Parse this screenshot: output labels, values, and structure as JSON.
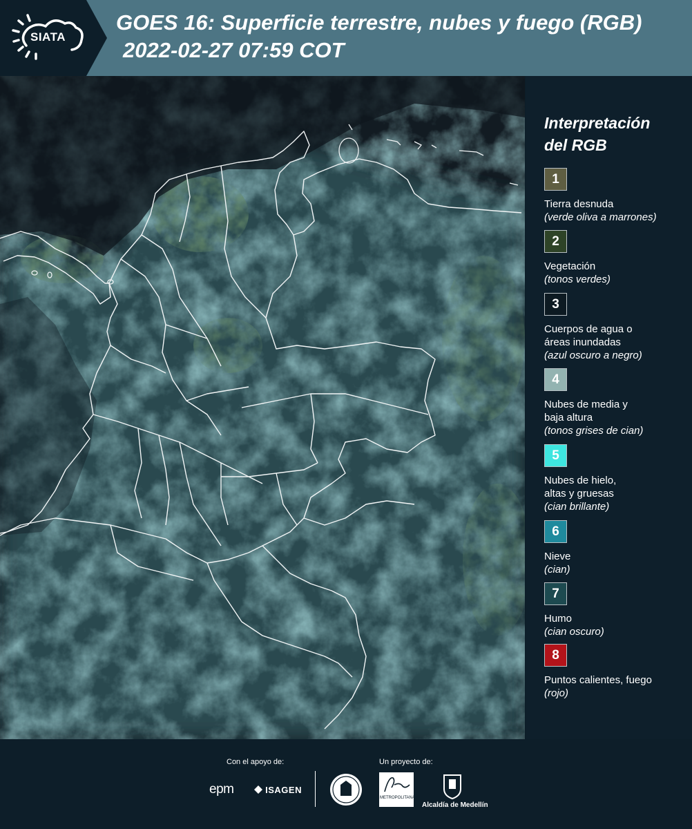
{
  "header": {
    "logo_text": "SIATA",
    "title": "GOES 16: Superficie terrestre, nubes y fuego (RGB)",
    "datetime": "2022-02-27 07:59 COT"
  },
  "legend": {
    "title_line1": "Interpretación",
    "title_line2": "del RGB",
    "items": [
      {
        "num": "1",
        "label": "Tierra desnuda",
        "label2": "",
        "sub": "(verde oliva a marrones)",
        "color": "#5f5e42"
      },
      {
        "num": "2",
        "label": "Vegetación",
        "label2": "",
        "sub": "(tonos verdes)",
        "color": "#2e4327"
      },
      {
        "num": "3",
        "label": "Cuerpos de agua o",
        "label2": "áreas inundadas",
        "sub": "(azul oscuro a negro)",
        "color": "#0d1a22"
      },
      {
        "num": "4",
        "label": "Nubes de media y",
        "label2": "baja altura",
        "sub": "(tonos grises de cian)",
        "color": "#93b3b1"
      },
      {
        "num": "5",
        "label": "Nubes de hielo,",
        "label2": "altas y gruesas",
        "sub": "(cian brillante)",
        "color": "#3ee6e0"
      },
      {
        "num": "6",
        "label": "Nieve",
        "label2": "",
        "sub": "(cian)",
        "color": "#1f8a9d"
      },
      {
        "num": "7",
        "label": "Humo",
        "label2": "",
        "sub": "(cian oscuro)",
        "color": "#1d4a50"
      },
      {
        "num": "8",
        "label": "Puntos calientes, fuego",
        "label2": "",
        "sub": "(rojo)",
        "color": "#b3131a"
      }
    ]
  },
  "footer": {
    "support_label": "Con el apoyo de:",
    "project_label": "Un proyecto de:",
    "epm": "epm",
    "isagen": "ISAGEN",
    "area_text": "METROPOLITANA",
    "alcaldia": "Alcaldía de Medellín"
  }
}
